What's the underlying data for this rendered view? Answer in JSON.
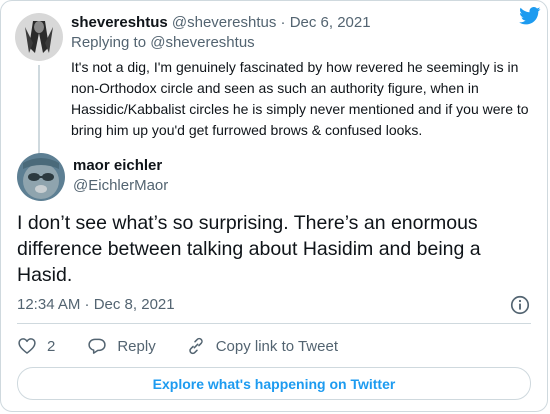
{
  "parent_tweet": {
    "author_name": "shevereshtus",
    "author_handle": "@shevereshtus",
    "separator": "·",
    "date": "Dec 6, 2021",
    "replying_to_prefix": "Replying to",
    "replying_to_handle": "@shevereshtus",
    "text": "It's not a dig, I'm genuinely fascinated by how revered he seemingly is in non-Orthodox circle and seen as such an authority figure, when in Hassidic/Kabbalist circles he is simply never mentioned and if you were to bring him up you'd get furrowed brows & confused looks."
  },
  "main_tweet": {
    "author_name": "maor eichler",
    "author_handle": "@EichlerMaor",
    "text": "I don’t see what’s so surprising. There’s an enormous difference between talking about Hasidim and being a Hasid.",
    "timestamp": "12:34 AM · Dec 8, 2021"
  },
  "actions": {
    "like_count": "2",
    "reply_label": "Reply",
    "copy_link_label": "Copy link to Tweet"
  },
  "explore_label": "Explore what's happening on Twitter",
  "colors": {
    "accent": "#1d9bf0",
    "secondary_text": "#536471",
    "border": "#cfd9de"
  },
  "icons": {
    "brand": "twitter-bird-icon",
    "info": "info-icon",
    "like": "heart-icon",
    "reply": "reply-bubble-icon",
    "copy": "link-icon"
  }
}
